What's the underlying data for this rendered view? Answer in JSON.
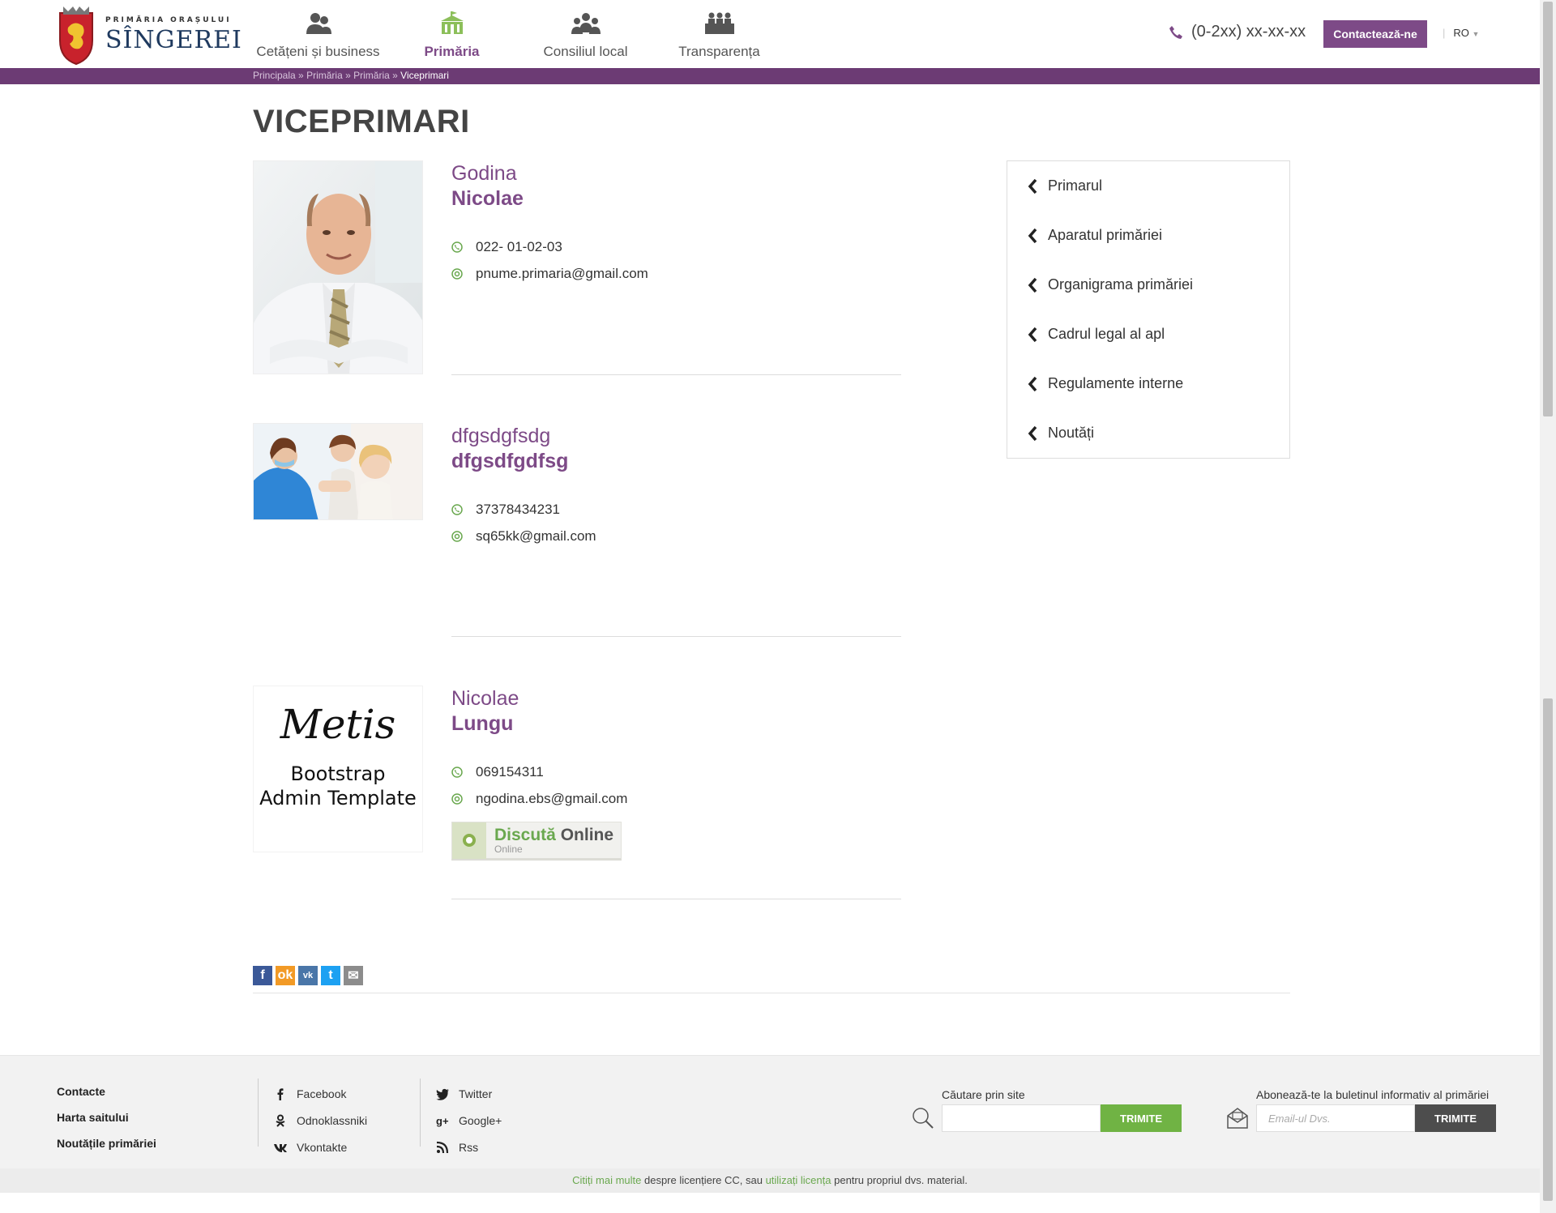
{
  "header": {
    "logo_small": "PRIMĂRIA ORAȘULUI",
    "logo_big": "SÎNGEREI",
    "nav": [
      {
        "label": "Cetățeni și business",
        "icon": "citizens-icon"
      },
      {
        "label": "Primăria",
        "icon": "city-hall-icon"
      },
      {
        "label": "Consiliul local",
        "icon": "council-icon"
      },
      {
        "label": "Transparența",
        "icon": "transparency-icon"
      }
    ],
    "active_nav": "Primăria",
    "phone": "(0-2xx) xx-xx-xx",
    "contact_button": "Contactează-ne",
    "lang": "RO"
  },
  "breadcrumb": {
    "items": [
      "Principala",
      "Primăria",
      "Primăria"
    ],
    "separator": "»",
    "current": "Viceprimari"
  },
  "page_title": "VICEPRIMARI",
  "persons": [
    {
      "first": "Godina",
      "last": "Nicolae",
      "phone": "022- 01-02-03",
      "email": "pnume.primaria@gmail.com"
    },
    {
      "first": "dfgsdgfsdg",
      "last": "dfgsdfgdfsg",
      "phone": "37378434231",
      "email": "sq65kk@gmail.com"
    },
    {
      "first": "Nicolae",
      "last": "Lungu",
      "phone": "069154311",
      "email": "ngodina.ebs@gmail.com",
      "photo_text": {
        "brand": "Metis",
        "line1": "Bootstrap",
        "line2": "Admin Template"
      }
    }
  ],
  "chat": {
    "word1": "Discută",
    "word2": "Online",
    "status": "Online"
  },
  "sidebar": [
    "Primarul",
    "Aparatul primăriei",
    "Organigrama primăriei",
    "Cadrul legal al apl",
    "Regulamente interne",
    "Noutăți"
  ],
  "share_icons": [
    "facebook-icon",
    "odnoklassniki-icon",
    "vkontakte-icon",
    "twitter-icon",
    "email-icon"
  ],
  "footer": {
    "links": [
      "Contacte",
      "Harta saitului",
      "Noutățile primăriei"
    ],
    "social_col1": [
      "Facebook",
      "Odnoklassniki",
      "Vkontakte"
    ],
    "social_col2": [
      "Twitter",
      "Google+",
      "Rss"
    ],
    "search_label": "Căutare prin site",
    "search_button": "TRIMITE",
    "subscribe_label": "Abonează-te la buletinul informativ al primăriei",
    "subscribe_placeholder": "Email-ul Dvs.",
    "subscribe_button": "TRIMITE"
  },
  "license": {
    "link1": "Citiți mai multe",
    "text1": " despre licențiere CC, sau ",
    "link2": "utilizați licența",
    "text2": " pentru propriul dvs. material."
  },
  "colors": {
    "brand": "#7d4a87",
    "breadcrumb_bar": "#6c3b74",
    "green": "#70b344"
  }
}
